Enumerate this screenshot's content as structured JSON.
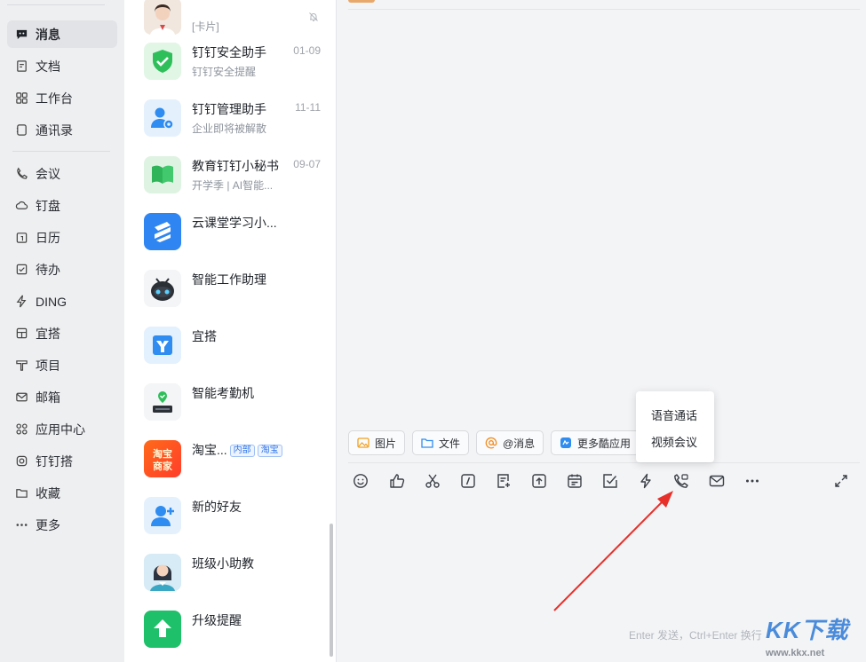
{
  "sidebar": {
    "items": [
      {
        "label": "消息",
        "icon": "chat-bubble-icon",
        "active": true
      },
      {
        "label": "文档",
        "icon": "document-icon"
      },
      {
        "label": "工作台",
        "icon": "grid-icon"
      },
      {
        "label": "通讯录",
        "icon": "contacts-icon"
      },
      {
        "label": "会议",
        "icon": "phone-icon"
      },
      {
        "label": "钉盘",
        "icon": "cloud-icon"
      },
      {
        "label": "日历",
        "icon": "calendar-icon"
      },
      {
        "label": "待办",
        "icon": "checkbox-icon"
      },
      {
        "label": "DING",
        "icon": "lightning-icon"
      },
      {
        "label": "宜搭",
        "icon": "build-icon"
      },
      {
        "label": "项目",
        "icon": "project-icon"
      },
      {
        "label": "邮箱",
        "icon": "mail-icon"
      },
      {
        "label": "应用中心",
        "icon": "apps-icon"
      },
      {
        "label": "钉钉搭",
        "icon": "dingda-icon"
      },
      {
        "label": "收藏",
        "icon": "folder-icon"
      },
      {
        "label": "更多",
        "icon": "more-icon"
      }
    ]
  },
  "conversations": [
    {
      "title": "",
      "subtitle": "[卡片]",
      "time": "",
      "avatar": "person-photo-avatar",
      "muted": true
    },
    {
      "title": "钉钉安全助手",
      "subtitle": "钉钉安全提醒",
      "time": "01-09",
      "avatar": "shield-check-avatar"
    },
    {
      "title": "钉钉管理助手",
      "subtitle": "企业即将被解散",
      "time": "11-11",
      "avatar": "admin-gear-avatar"
    },
    {
      "title": "教育钉钉小秘书",
      "subtitle": "开学季 | AI智能...",
      "time": "09-07",
      "avatar": "book-avatar"
    },
    {
      "title": "云课堂学习小...",
      "subtitle": "",
      "time": "",
      "avatar": "cloud-class-avatar"
    },
    {
      "title": "智能工作助理",
      "subtitle": "",
      "time": "",
      "avatar": "robot-avatar"
    },
    {
      "title": "宜搭",
      "subtitle": "",
      "time": "",
      "avatar": "yida-avatar"
    },
    {
      "title": "智能考勤机",
      "subtitle": "",
      "time": "",
      "avatar": "attendance-device-avatar"
    },
    {
      "title": "淘宝...",
      "subtitle": "",
      "time": "",
      "avatar": "taobao-merchant-avatar",
      "tags": [
        "内部",
        "淘宝"
      ],
      "avatar_text": "淘宝商家"
    },
    {
      "title": "新的好友",
      "subtitle": "",
      "time": "",
      "avatar": "add-friend-avatar"
    },
    {
      "title": "班级小助教",
      "subtitle": "",
      "time": "",
      "avatar": "teacher-avatar"
    },
    {
      "title": "升级提醒",
      "subtitle": "",
      "time": "",
      "avatar": "upgrade-arrow-avatar"
    }
  ],
  "chat": {
    "quick_chips": [
      {
        "label": "图片",
        "icon": "image-icon"
      },
      {
        "label": "文件",
        "icon": "folder-icon"
      },
      {
        "label": "@消息",
        "icon": "at-icon"
      },
      {
        "label": "更多酷应用",
        "icon": "cool-app-icon"
      }
    ],
    "toolbar": [
      "emoji-icon",
      "thumbs-up-icon",
      "scissors-icon",
      "slash-command-icon",
      "note-add-icon",
      "upload-icon",
      "calendar-icon",
      "task-check-icon",
      "ding-lightning-icon",
      "phone-call-icon",
      "mail-icon",
      "more-dots-icon"
    ],
    "expand_icon": "expand-icon",
    "call_menu": {
      "voice": "语音通话",
      "video": "视频会议"
    },
    "input_hint": "Enter 发送，Ctrl+Enter 换行"
  },
  "watermark": {
    "logo": "KK下载",
    "url": "www.kkx.net"
  },
  "colors": {
    "accent": "#2f75e8",
    "annotation_arrow": "#e8302a"
  }
}
